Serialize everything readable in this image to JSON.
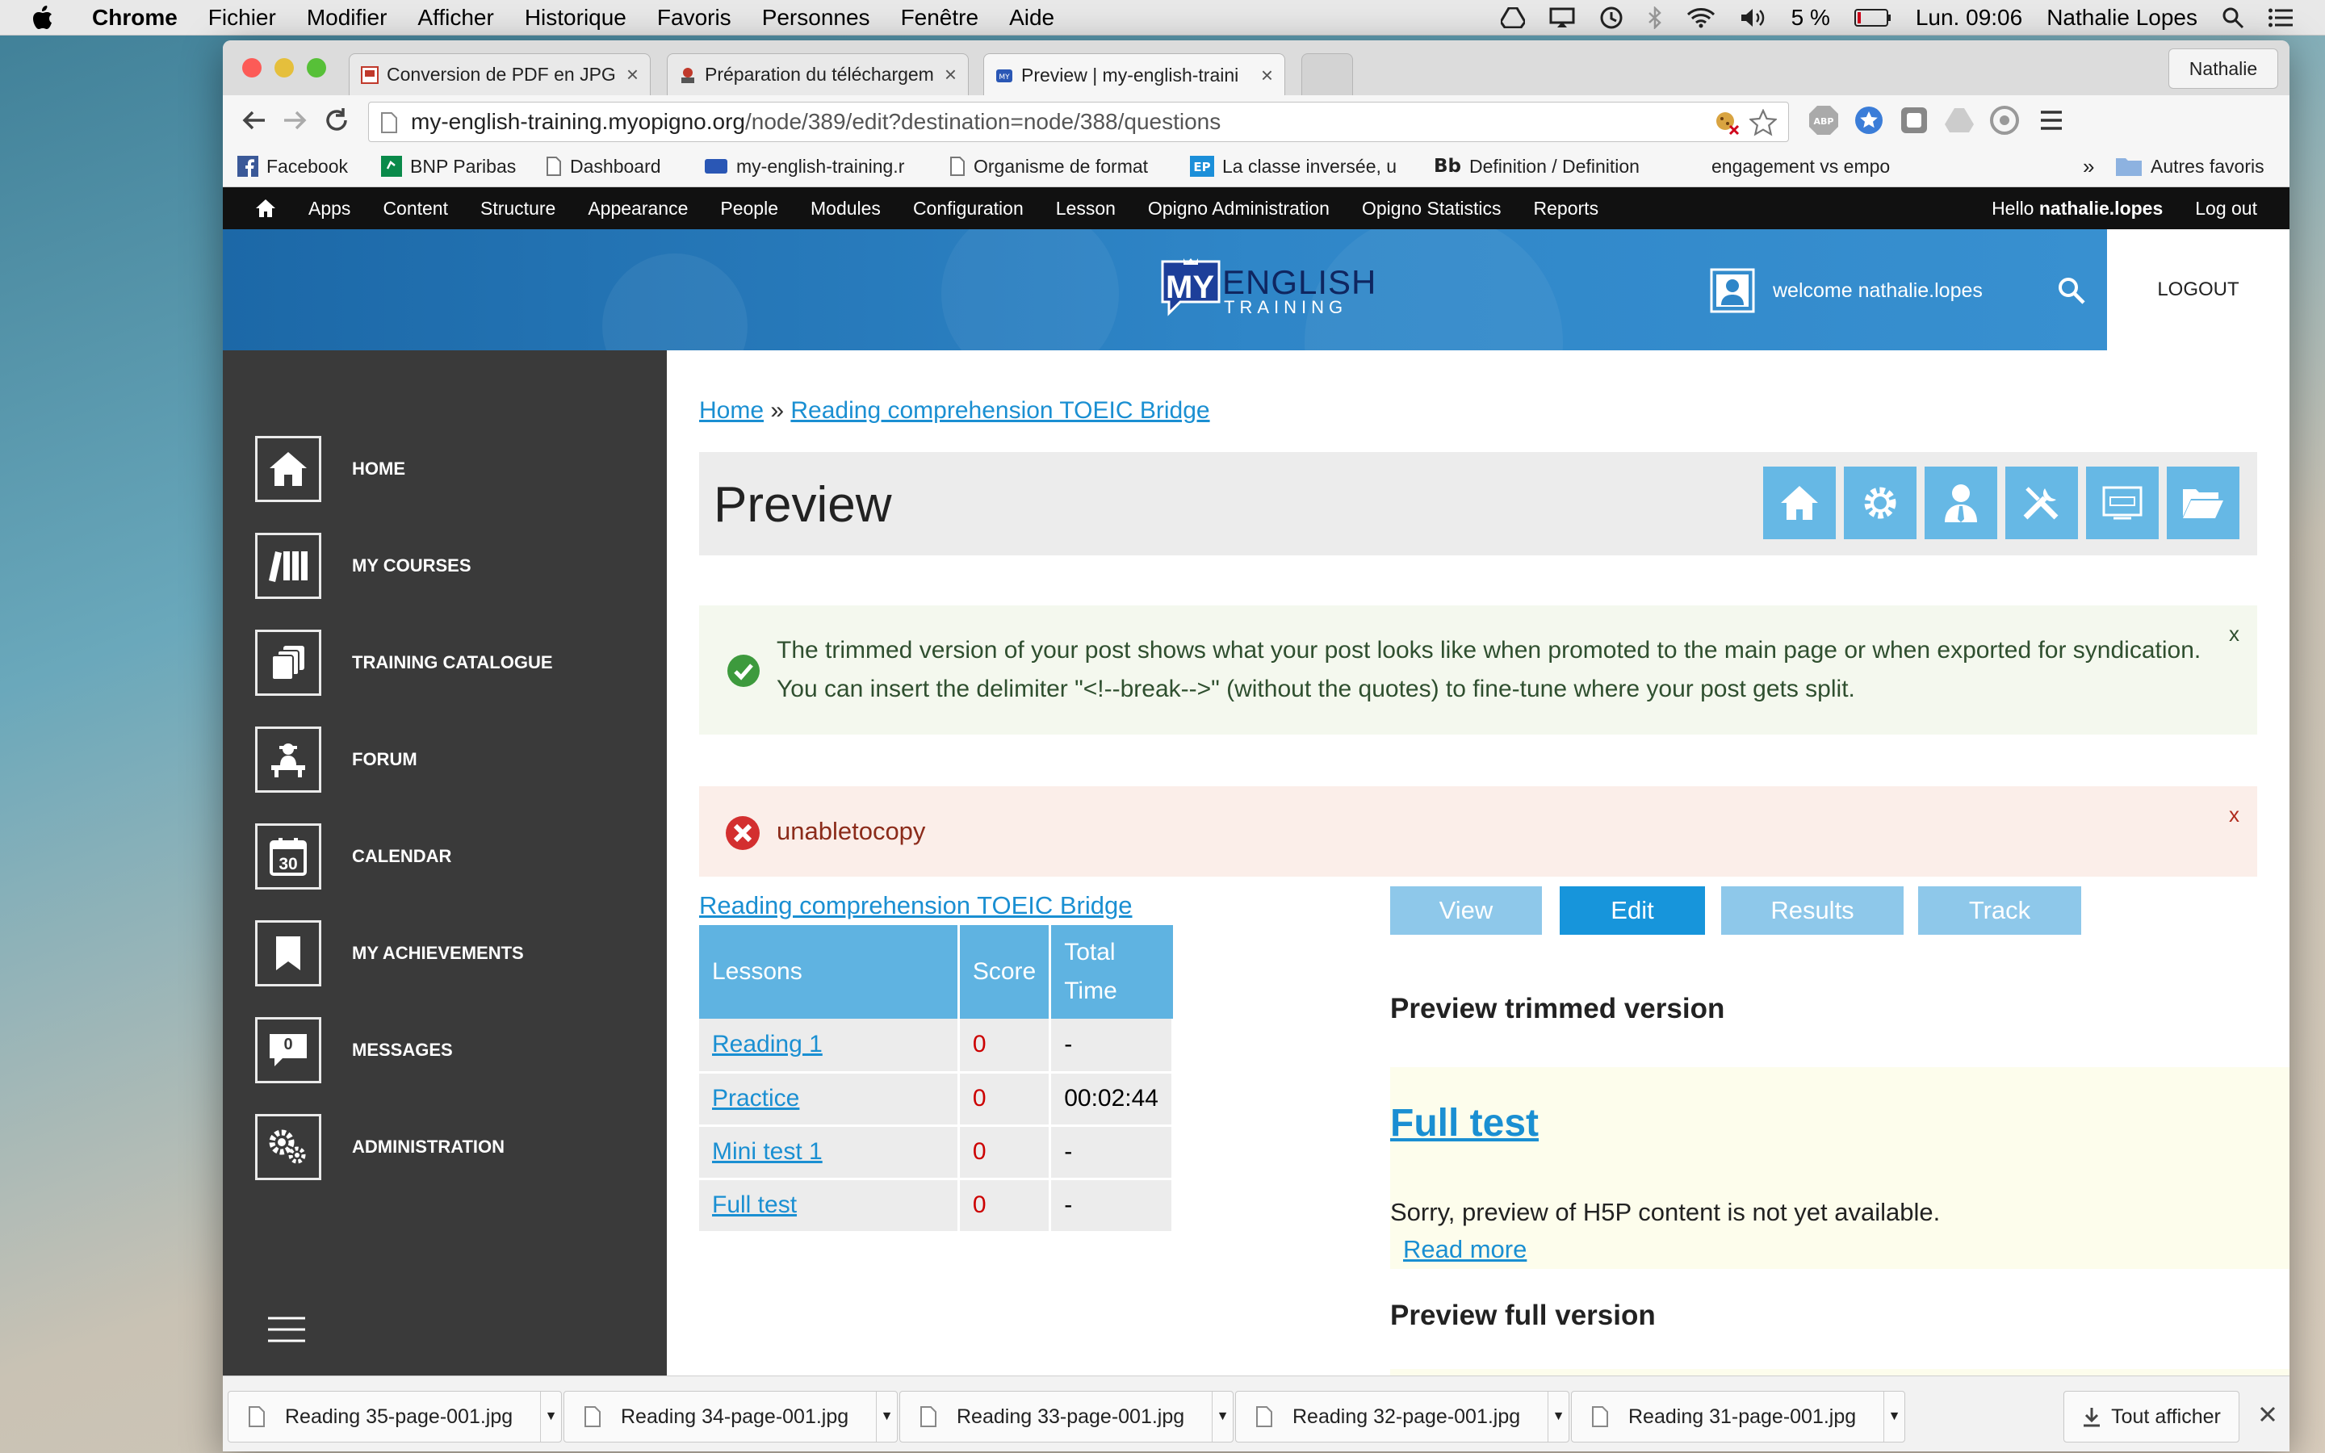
{
  "os_menubar": {
    "app": "Chrome",
    "menus": [
      "Fichier",
      "Modifier",
      "Afficher",
      "Historique",
      "Favoris",
      "Personnes",
      "Fenêtre",
      "Aide"
    ],
    "battery": "5 %",
    "clock": "Lun. 09:06",
    "user": "Nathalie Lopes"
  },
  "browser": {
    "tabs": [
      {
        "title": "Conversion de PDF en JPG"
      },
      {
        "title": "Préparation du téléchargem"
      },
      {
        "title": "Preview | my-english-traini"
      }
    ],
    "profile": "Nathalie",
    "url_host": "my-english-training.myopigno.org",
    "url_path": "/node/389/edit?destination=node/388/questions",
    "bookmarks": [
      "Facebook",
      "BNP Paribas",
      "Dashboard",
      "my-english-training.r",
      "Organisme de format",
      "La classe inversée, u",
      "Definition / Definition",
      "engagement vs empo"
    ],
    "bookmarks_more": "»",
    "other_bookmarks": "Autres favoris"
  },
  "admin_toolbar": {
    "items": [
      "Apps",
      "Content",
      "Structure",
      "Appearance",
      "People",
      "Modules",
      "Configuration",
      "Lesson",
      "Opigno Administration",
      "Opigno Statistics",
      "Reports"
    ],
    "hello_prefix": "Hello ",
    "username": "nathalie.lopes",
    "logout": "Log out"
  },
  "site_header": {
    "logo_my": "MY",
    "logo_english": "ENGLISH",
    "logo_training": "TRAINING",
    "welcome": "welcome nathalie.lopes",
    "logout": "LOGOUT"
  },
  "sidebar": {
    "items": [
      {
        "label": "HOME",
        "icon": "home-icon"
      },
      {
        "label": "MY COURSES",
        "icon": "books-icon"
      },
      {
        "label": "TRAINING CATALOGUE",
        "icon": "catalogue-icon"
      },
      {
        "label": "FORUM",
        "icon": "forum-icon"
      },
      {
        "label": "CALENDAR",
        "icon": "calendar-icon",
        "day": "30"
      },
      {
        "label": "MY ACHIEVEMENTS",
        "icon": "bookmark-icon"
      },
      {
        "label": "MESSAGES",
        "icon": "message-icon",
        "count": "0"
      },
      {
        "label": "ADMINISTRATION",
        "icon": "gears-icon"
      }
    ]
  },
  "main": {
    "breadcrumb": {
      "home": "Home",
      "sep": " » ",
      "course": "Reading comprehension TOEIC Bridge"
    },
    "title": "Preview",
    "status_message": "The trimmed version of your post shows what your post looks like when promoted to the main page or when exported for syndication. You can insert the delimiter \"<!--break-->\" (without the quotes) to fine-tune where your post gets split.",
    "error_message": "unabletocopy",
    "close": "x",
    "course_link": "Reading comprehension TOEIC Bridge",
    "table": {
      "headers": [
        "Lessons",
        "Score",
        "Total Time"
      ],
      "rows": [
        {
          "lesson": "Reading 1",
          "score": "0",
          "time": "-"
        },
        {
          "lesson": "Practice",
          "score": "0",
          "time": "00:02:44"
        },
        {
          "lesson": "Mini test 1",
          "score": "0",
          "time": "-"
        },
        {
          "lesson": "Full test",
          "score": "0",
          "time": "-"
        }
      ]
    },
    "tabs": [
      "View",
      "Edit",
      "Results",
      "Track"
    ],
    "active_tab": "Edit",
    "preview_trimmed_heading": "Preview trimmed version",
    "node_title": "Full test",
    "h5p_notice": "Sorry, preview of H5P content is not yet available.",
    "read_more": "Read more",
    "preview_full_heading": "Preview full version"
  },
  "downloads": {
    "files": [
      "Reading 35-page-001.jpg",
      "Reading 34-page-001.jpg",
      "Reading 33-page-001.jpg",
      "Reading 32-page-001.jpg",
      "Reading 31-page-001.jpg"
    ],
    "show_all": "Tout afficher"
  },
  "colors": {
    "accent": "#1795db",
    "sidebar": "#3a3a3a",
    "success_bg": "#f4f8ee",
    "error_bg": "#fbeee9"
  }
}
